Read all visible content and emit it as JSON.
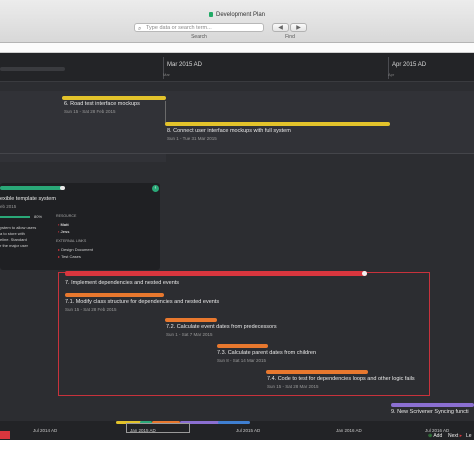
{
  "window": {
    "title": "Development Plan"
  },
  "toolbar": {
    "search_placeholder": "Type data or search term...",
    "search_label": "Search",
    "back_arrow": "◀",
    "forward_arrow": "▶",
    "find_label": "Find"
  },
  "timeline": {
    "months": [
      {
        "label": "Mar 2015 AD",
        "sub": "Mar"
      },
      {
        "label": "Apr 2015 AD",
        "sub": "Apr"
      }
    ]
  },
  "tasks": {
    "t6": {
      "name": "6. Road test interface mockups",
      "dates": "Sun 15 - Sat 28 Feb 2015"
    },
    "t8": {
      "name": "8. Connect user interface mockups with full system",
      "dates": "Sun 1 - Tue 31 Mar 2015"
    },
    "t7": {
      "name": "7. Implement dependencies and nested events"
    },
    "t71": {
      "name": "7.1. Modify class structure for dependencies and nested events",
      "dates": "Sun 15 - Sat 28 Feb 2015"
    },
    "t72": {
      "name": "7.2. Calculate event dates from predecessors",
      "dates": "Sun 1 - Sat 7 Mar 2015"
    },
    "t73": {
      "name": "7.3. Calculate parent dates from children",
      "dates": "Sun 8 - Sat 14 Mar 2015"
    },
    "t74": {
      "name": "7.4. Code to test for dependencies loops and other logic fails",
      "dates": "Sun 15 - Sat 28 Mar 2015"
    },
    "t9": {
      "name": "9. New Scrivener Syncing functi"
    }
  },
  "popover": {
    "title": "exible template system",
    "date": "eb 2015",
    "percent": "80%",
    "desc": [
      "ystem to allow users",
      "a to store with",
      "eline. Standard",
      "r the major user"
    ],
    "resource_heading": "RESOURCE",
    "resources": [
      "Matt",
      "Jess"
    ],
    "links_heading": "EXTERNAL LINKS",
    "links": [
      "Design Document",
      "Test Cases"
    ]
  },
  "overview": {
    "labels": [
      "Jul 2014 AD",
      "Jan 2015 AD",
      "Jul 2015 AD",
      "Jan 2016 AD",
      "Jul 2016 AD"
    ]
  },
  "footer": {
    "add": "Add",
    "next": "Next",
    "cut": "Le"
  },
  "colors": {
    "yellow": "#e3c32b",
    "orange": "#e8782e",
    "red": "#d9363e",
    "teal": "#2aa878",
    "purple": "#8b6fd1",
    "chart_bg": "#2c2d31"
  }
}
